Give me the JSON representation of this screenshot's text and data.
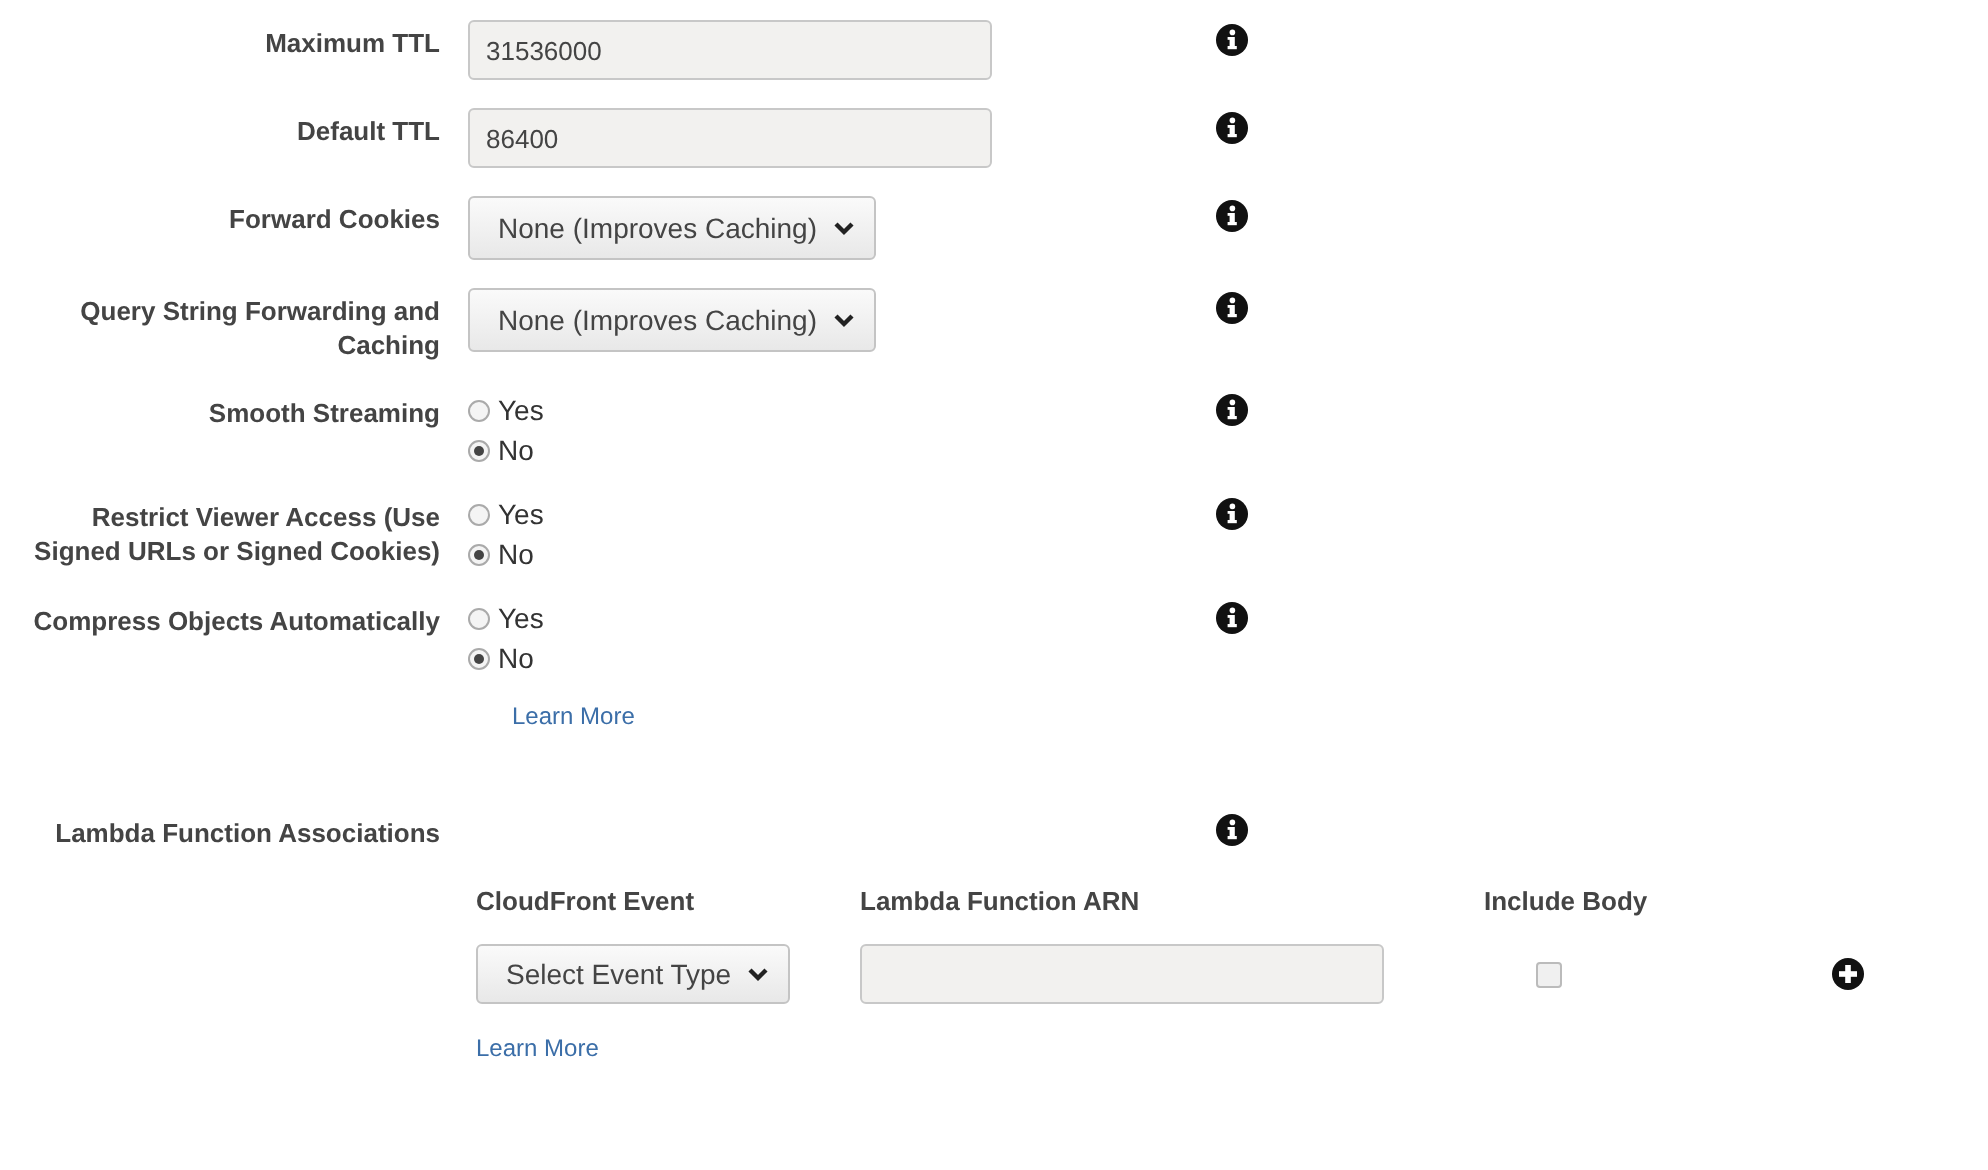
{
  "settings": [
    {
      "kind": "text",
      "label": "Maximum TTL",
      "value": "31536000"
    },
    {
      "kind": "text",
      "label": "Default TTL",
      "value": "86400"
    },
    {
      "kind": "select",
      "label": "Forward Cookies",
      "value": "None (Improves Caching)"
    },
    {
      "kind": "select",
      "label": "Query String Forwarding and Caching",
      "value": "None (Improves Caching)"
    },
    {
      "kind": "radio",
      "label": "Smooth Streaming",
      "options": [
        {
          "label": "Yes",
          "selected": false
        },
        {
          "label": "No",
          "selected": true
        }
      ]
    },
    {
      "kind": "radio",
      "label": "Restrict Viewer Access (Use Signed URLs or Signed Cookies)",
      "options": [
        {
          "label": "Yes",
          "selected": false
        },
        {
          "label": "No",
          "selected": true
        }
      ]
    },
    {
      "kind": "radio",
      "label": "Compress Objects Automatically",
      "options": [
        {
          "label": "Yes",
          "selected": false
        },
        {
          "label": "No",
          "selected": true
        }
      ],
      "link": "Learn More"
    }
  ],
  "lambda": {
    "title": "Lambda Function Associations",
    "columns": [
      "CloudFront Event",
      "Lambda Function ARN",
      "Include Body"
    ],
    "row": {
      "event": "Select Event Type",
      "include_body": false
    },
    "link": "Learn More"
  }
}
